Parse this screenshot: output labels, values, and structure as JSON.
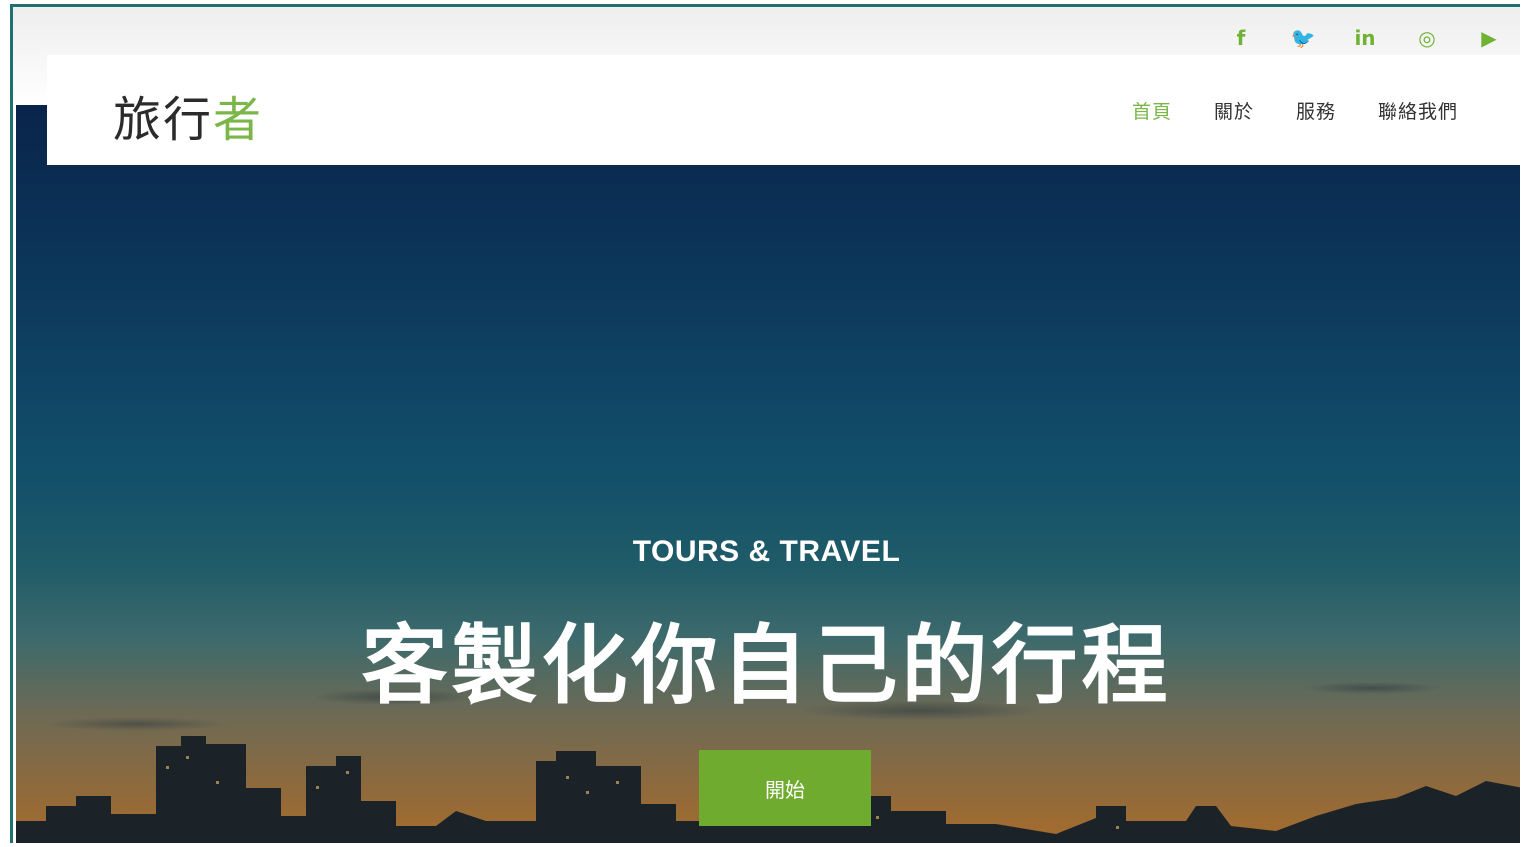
{
  "brand": {
    "logo_part1": "旅行",
    "logo_part2": "者"
  },
  "social": [
    {
      "icon": "facebook-icon",
      "glyph": "f"
    },
    {
      "icon": "twitter-icon",
      "glyph": "🐦"
    },
    {
      "icon": "linkedin-icon",
      "glyph": "in"
    },
    {
      "icon": "instagram-icon",
      "glyph": "◎"
    },
    {
      "icon": "youtube-icon",
      "glyph": "▶"
    }
  ],
  "nav": {
    "items": [
      {
        "label": "首頁"
      },
      {
        "label": "關於"
      },
      {
        "label": "服務"
      },
      {
        "label": "聯絡我們"
      }
    ]
  },
  "hero": {
    "subtitle": "TOURS & TRAVEL",
    "headline": "客製化你自己的行程",
    "cta_label": "開始"
  },
  "colors": {
    "accent": "#7ab648",
    "button": "#6eab2f",
    "frame": "#1f6f73"
  }
}
